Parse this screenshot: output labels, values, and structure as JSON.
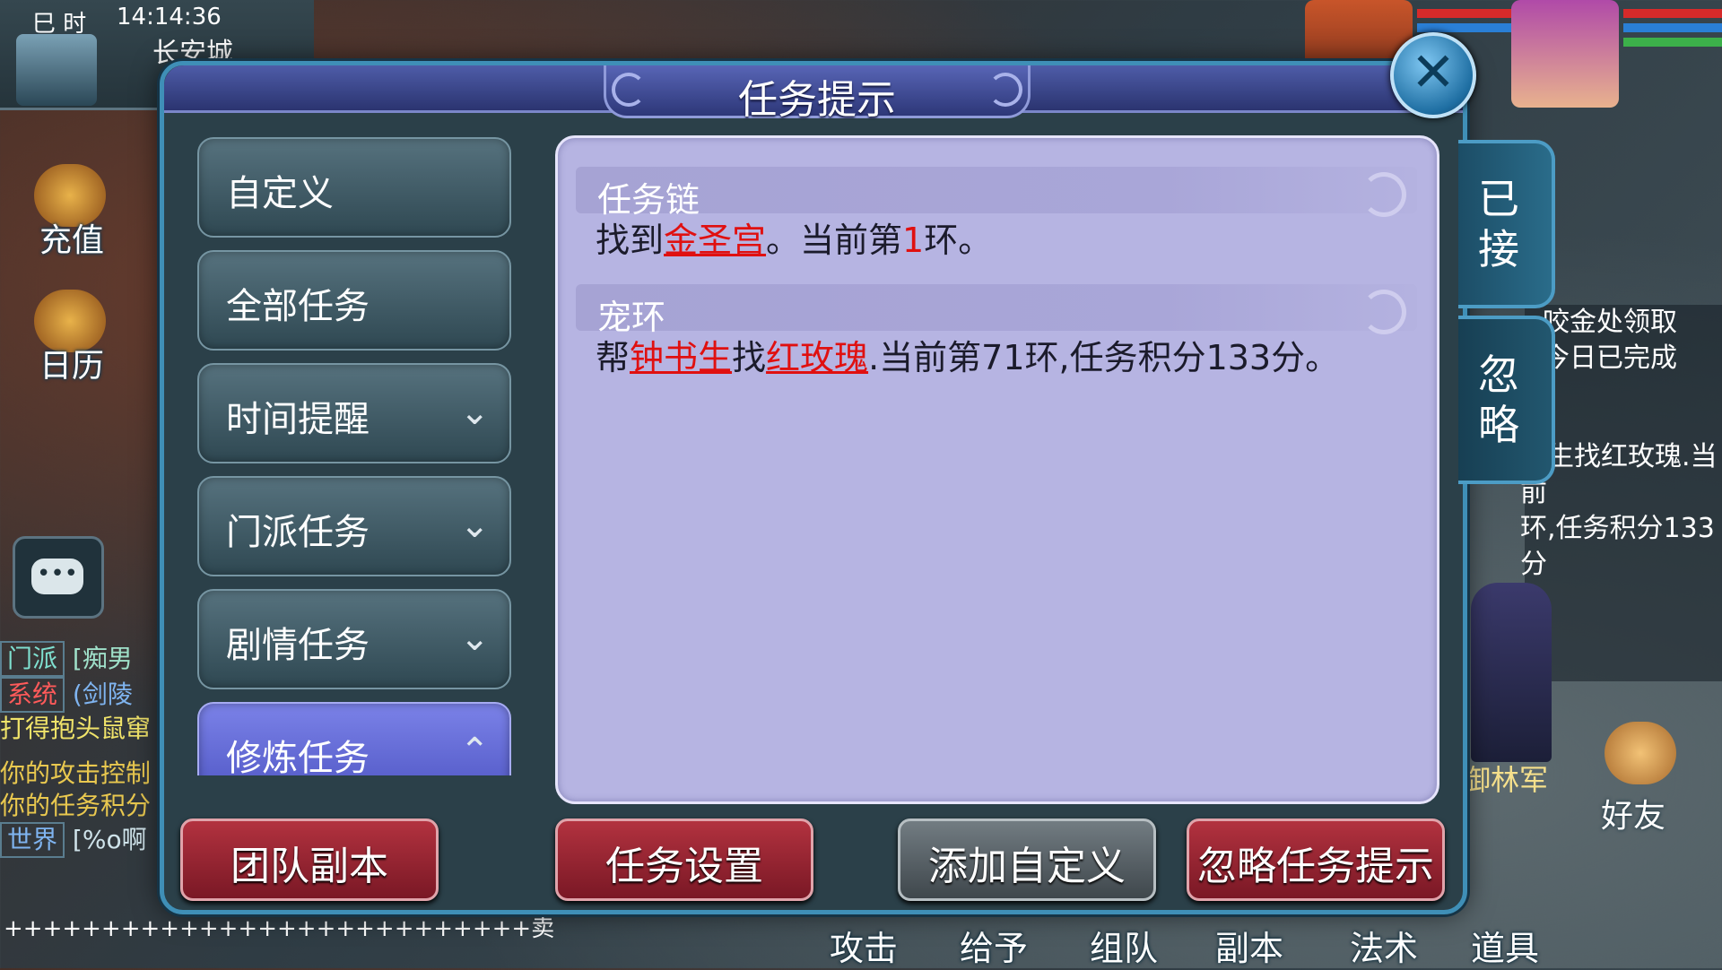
{
  "hud": {
    "time_prefix": "巳 时",
    "clock": "14:14:36",
    "city": "长安城",
    "recharge_label": "充值",
    "calendar_label": "日历",
    "chat_icon": "chat-bubble-icon",
    "sell_line": "+++++++++++++++++++++++++++卖"
  },
  "chat": {
    "lines": [
      {
        "tag": "门派",
        "text": "[痴男"
      },
      {
        "tag": "系统",
        "text": "(剑陵"
      },
      {
        "tag": "",
        "text": "打得抱头鼠窜"
      },
      {
        "tag": "",
        "text": "你的攻击控制"
      },
      {
        "tag": "",
        "text": "你的任务积分"
      },
      {
        "tag": "世界",
        "text": "[%o啊"
      }
    ]
  },
  "right_panel": {
    "line1": "咬金处领取",
    "line2": "今日已完成",
    "line3": "书生找红玫瑰.当前",
    "line4": "环,任务积分133分"
  },
  "npc_name": "御林军",
  "friend_label": "好友",
  "bottom_menu": [
    "攻击",
    "给予",
    "组队",
    "副本",
    "法术",
    "道具"
  ],
  "dialog": {
    "title": "任务提示",
    "close_icon": "close-icon",
    "categories": [
      {
        "label": "自定义",
        "expandable": false,
        "active": false
      },
      {
        "label": "全部任务",
        "expandable": false,
        "active": false
      },
      {
        "label": "时间提醒",
        "expandable": true,
        "active": false
      },
      {
        "label": "门派任务",
        "expandable": true,
        "active": false
      },
      {
        "label": "剧情任务",
        "expandable": true,
        "active": false
      },
      {
        "label": "修炼任务",
        "expandable": true,
        "active": true
      }
    ],
    "chevron_down": "⌄",
    "chevron_up": "⌃",
    "tasks": [
      {
        "name": "任务链",
        "desc_parts": [
          "找到",
          "金圣宫",
          "。当前第",
          "1",
          "环。"
        ]
      },
      {
        "name": "宠环",
        "desc_parts": [
          "帮",
          "钟书生",
          "找",
          "红玫瑰",
          ".当前第71环,任务积分133分。"
        ]
      }
    ],
    "side_tabs": [
      {
        "label_top": "已",
        "label_bottom": "接"
      },
      {
        "label_top": "忽",
        "label_bottom": "略"
      }
    ],
    "buttons": {
      "team_dungeon": "团队副本",
      "task_settings": "任务设置",
      "add_custom": "添加自定义",
      "ignore_hints": "忽略任务提示"
    }
  },
  "colors": {
    "dialog_bg": "#2b4049",
    "content_bg": "#b6b4e2",
    "highlight_red": "#e01010",
    "active_tab": "#6b72df",
    "button_red": "#9a2431"
  }
}
